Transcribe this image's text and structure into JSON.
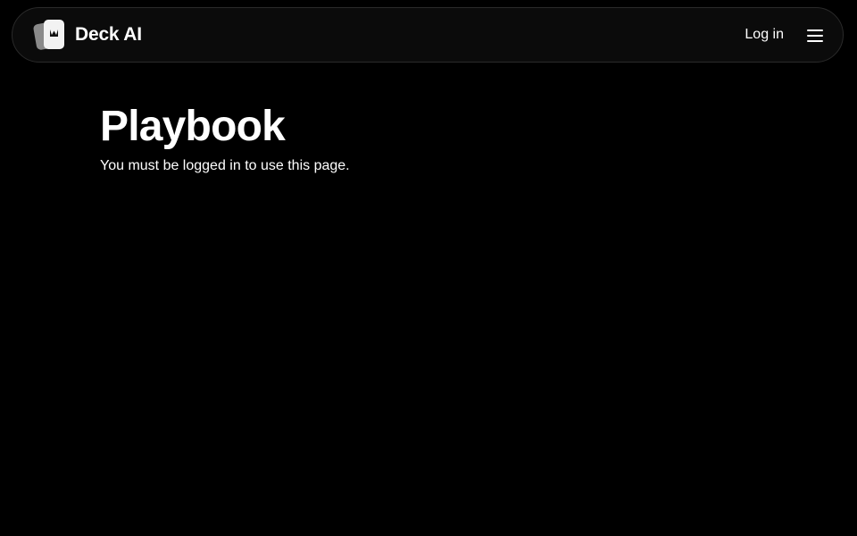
{
  "header": {
    "brand_name": "Deck AI",
    "language_glyph": "  ",
    "login_label": "Log in"
  },
  "main": {
    "title": "Playbook",
    "message": "You must be logged in to use this page."
  },
  "colors": {
    "background": "#000000",
    "navbar_background": "#0b0b0b",
    "navbar_border": "#2a2a2a",
    "text": "#ffffff"
  },
  "icons": {
    "logo": "card-deck-logo-icon",
    "language": "language-icon",
    "menu": "hamburger-menu-icon"
  }
}
